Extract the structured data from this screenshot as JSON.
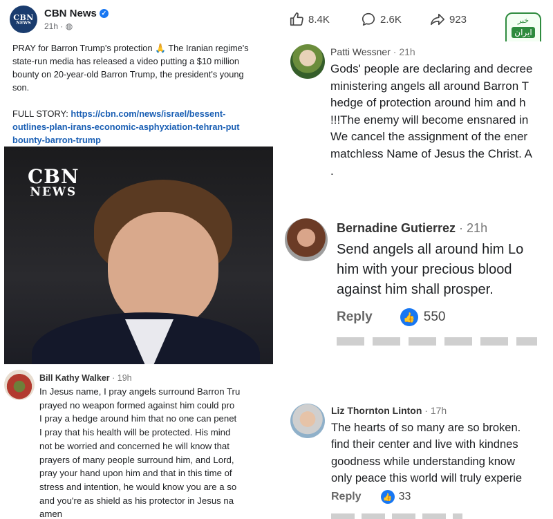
{
  "post": {
    "page_name": "CBN News",
    "time": "21h · ",
    "avatar_line1": "CBN",
    "avatar_line2": "NEWS",
    "text_lines": [
      "PRAY for Barron Trump's protection 🙏 The Iranian regime's",
      "state-run media has released a video putting a $10 million",
      "bounty on 20-year-old Barron Trump, the president's young",
      "son."
    ],
    "story_label": "FULL STORY: ",
    "story_link_lines": [
      "https://cbn.com/news/israel/bessent-",
      "outlines-plan-irans-economic-asphyxiation-tehran-put",
      "bounty-barron-trump"
    ],
    "image_watermark": [
      "CBN",
      "NEWS"
    ]
  },
  "reactions": {
    "likes": "8.4K",
    "comments": "2.6K",
    "shares": "923",
    "badge_top": "خبر",
    "badge_bottom": "ایران"
  },
  "comments": [
    {
      "author": "Patti Wessner",
      "time": " · 21h",
      "lines": [
        "Gods' people are declaring and decree",
        "ministering angels all around Barron T",
        "hedge of protection around him and h",
        "!!!The enemy will become ensnared in",
        "We cancel the assignment of the ener",
        "matchless Name of Jesus the Christ. A",
        "."
      ]
    },
    {
      "author": "Bernadine Gutierrez",
      "time": " · 21h",
      "lines": [
        "Send angels all around him Lo",
        "him with your precious blood",
        "against him shall prosper."
      ],
      "reply": "Reply",
      "likes": "550"
    },
    {
      "author": "Bill Kathy Walker",
      "time": " · 19h",
      "lines": [
        "In Jesus name, I pray angels surround Barron Tru",
        "prayed no weapon formed against him could pro",
        "I pray a hedge around him that no one can penet",
        "I pray that his health will be protected. His mind",
        "not be worried and concerned he will know that",
        "prayers of many people surround him, and Lord,",
        "pray your hand upon him and that in this time of",
        "stress and intention, he would know you are a so",
        "and you're as shield as his protector in Jesus na",
        "amen"
      ]
    },
    {
      "author": "Liz Thornton Linton",
      "time": " · 17h",
      "lines": [
        "The hearts of so many are so broken.",
        "find their center and live with kindnes",
        "goodness while understanding  know",
        "only peace this world will truly experie"
      ],
      "reply": "Reply",
      "likes": "33"
    }
  ],
  "colors": {
    "link": "#1a5fb4",
    "like_blue": "#1877f2",
    "badge_green": "#2e8b3e"
  },
  "icons": [
    "thumbs-up-icon",
    "comment-bubble-icon",
    "share-arrow-icon",
    "verified-icon",
    "globe-icon",
    "like-badge-icon"
  ]
}
